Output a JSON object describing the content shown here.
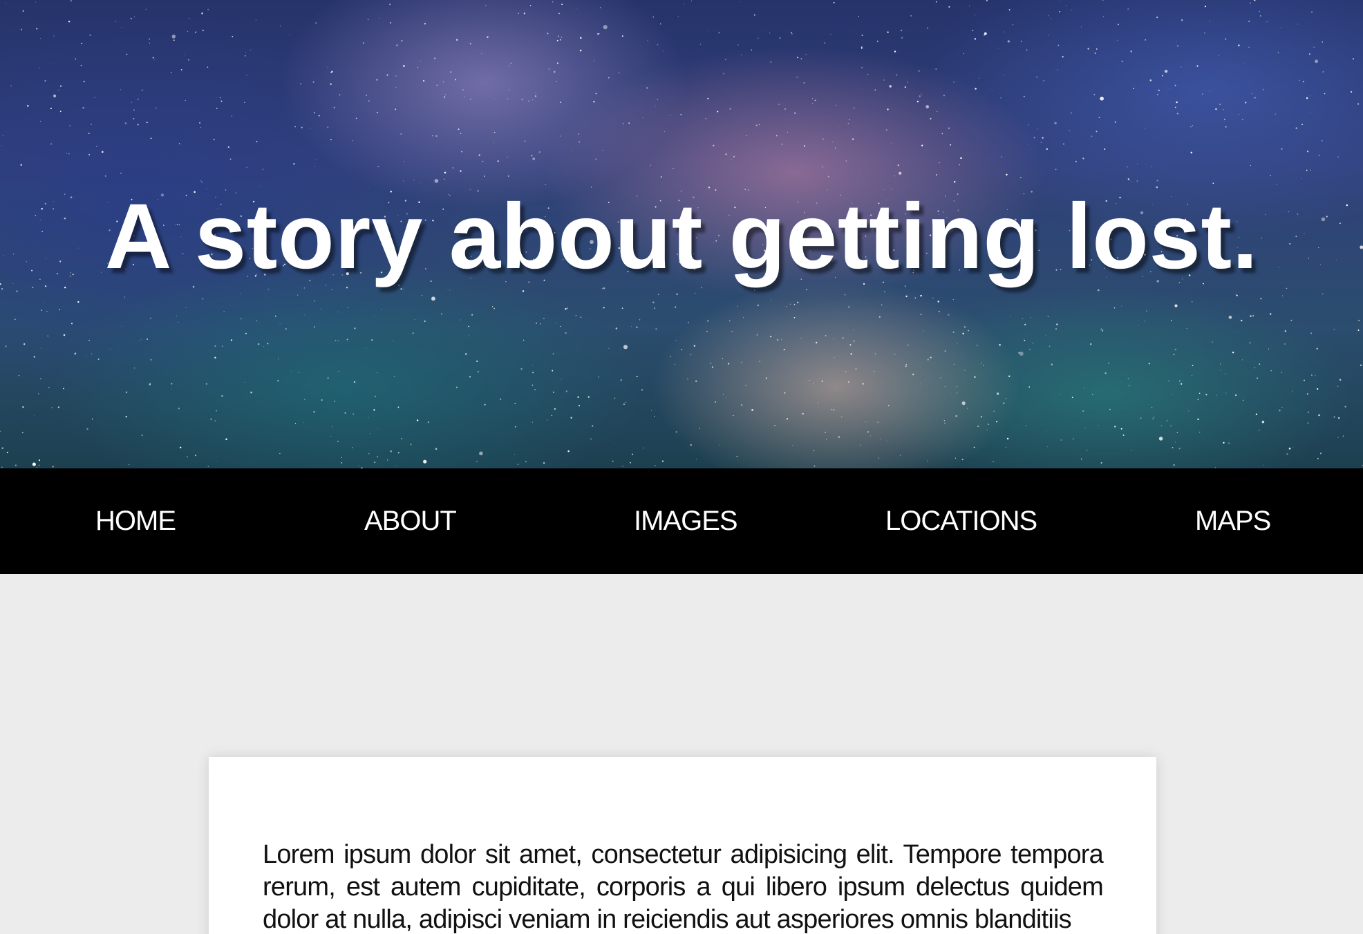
{
  "hero": {
    "title": "A story about getting lost.",
    "background": "starry-night-milky-way-image"
  },
  "nav": {
    "items": [
      {
        "label": "HOME"
      },
      {
        "label": "ABOUT"
      },
      {
        "label": "IMAGES"
      },
      {
        "label": "LOCATIONS"
      },
      {
        "label": "MAPS"
      }
    ]
  },
  "content": {
    "paragraph": "Lorem ipsum dolor sit amet, consectetur adipisicing elit. Tempore tempora rerum, est autem cupiditate, corporis a qui libero ipsum delectus quidem dolor at nulla, adipisci veniam in reiciendis aut asperiores omnis blanditiis"
  },
  "colors": {
    "nav_background": "#000000",
    "page_background": "#ececec",
    "card_background": "#ffffff",
    "hero_text": "#ffffff"
  }
}
